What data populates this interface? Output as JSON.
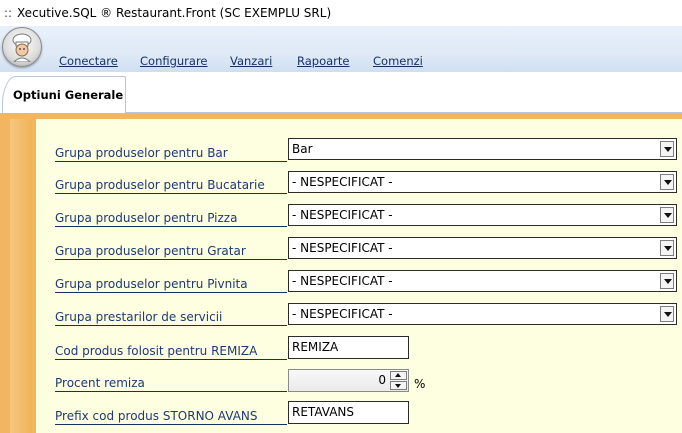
{
  "window": {
    "grip": "::",
    "title": "Xecutive.SQL  ®  Restaurant.Front (SC EXEMPLU SRL)"
  },
  "menu": {
    "items": [
      {
        "label": "Conectare"
      },
      {
        "label": "Configurare"
      },
      {
        "label": "Vanzari"
      },
      {
        "label": "Rapoarte"
      },
      {
        "label": "Comenzi"
      }
    ]
  },
  "tabs": [
    {
      "label": "Optiuni Generale",
      "active": true
    }
  ],
  "form": {
    "bar": {
      "label": "Grupa produselor pentru Bar",
      "value": "Bar"
    },
    "bucatarie": {
      "label": "Grupa produselor pentru Bucatarie",
      "value": "- NESPECIFICAT -"
    },
    "pizza": {
      "label": "Grupa produselor pentru Pizza",
      "value": "- NESPECIFICAT -"
    },
    "gratar": {
      "label": "Grupa produselor pentru Gratar",
      "value": "- NESPECIFICAT -"
    },
    "pivnita": {
      "label": "Grupa produselor pentru Pivnita",
      "value": "- NESPECIFICAT -"
    },
    "servicii": {
      "label": "Grupa prestarilor de servicii",
      "value": "- NESPECIFICAT -"
    },
    "remiza_cod": {
      "label": "Cod produs folosit pentru REMIZA",
      "value": "REMIZA"
    },
    "procent": {
      "label": "Procent remiza",
      "value": "0",
      "unit": "%"
    },
    "storno": {
      "label": "Prefix cod produs STORNO AVANS",
      "value": "RETAVANS"
    }
  },
  "colors": {
    "accent_frame": "#f2b661",
    "content_bg": "#fefee0",
    "label_text": "#1c3a74"
  },
  "icons": {
    "app_orb": "chef-icon",
    "combo_arrow": "chevron-down-icon"
  }
}
